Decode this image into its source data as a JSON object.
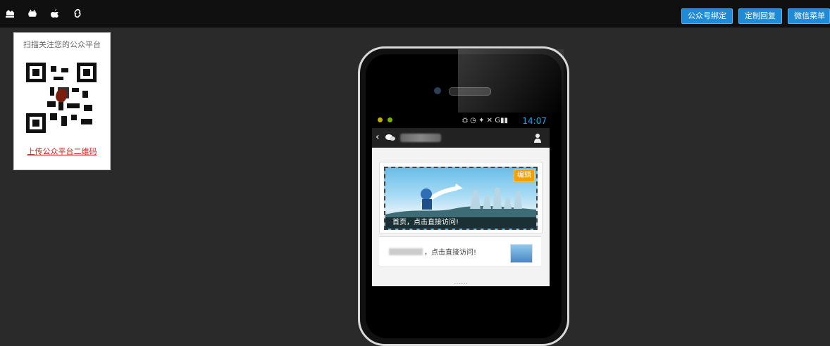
{
  "topbar": {
    "icons": [
      "custom-icon",
      "android-icon",
      "apple-icon",
      "link-icon"
    ],
    "buttons": [
      "公众号绑定",
      "定制回复",
      "微信菜单"
    ]
  },
  "qr_card": {
    "title": "扫描关注您的公众平台",
    "link": "上传公众平台二维码"
  },
  "phone_screen": {
    "status_time": "14:07",
    "banner_caption": "首页，点击直接访问!",
    "edit_label": "编辑",
    "row_text": "，点击直接访问!",
    "dots": "……"
  },
  "colors": {
    "topbar": "#101010",
    "accent_blue": "#1f8ad6",
    "link_red": "#d02020",
    "edit_orange": "#f4a000"
  }
}
